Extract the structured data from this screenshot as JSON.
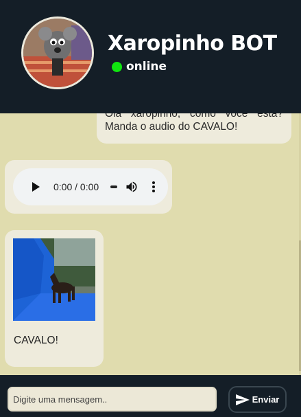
{
  "header": {
    "title": "Xaropinho BOT",
    "status": "online",
    "avatar_icon": "avatar-rat-puppet",
    "status_color": "#10e60f"
  },
  "messages": [
    {
      "from": "user",
      "lines": [
        "Olá xaropinho, como você está?",
        "Manda o audio do CAVALO!"
      ]
    },
    {
      "from": "bot",
      "type": "audio",
      "time": "0:00 / 0:00"
    },
    {
      "from": "bot",
      "type": "image",
      "image_icon": "horse-photo",
      "caption": "CAVALO!"
    }
  ],
  "composer": {
    "placeholder": "Digite uma mensagem..",
    "value": "",
    "send_label": "Enviar",
    "send_icon": "send-icon"
  },
  "colors": {
    "header_bg": "#141e27",
    "chat_bg": "#e0dcae",
    "bubble_bg": "#eeebdc"
  }
}
